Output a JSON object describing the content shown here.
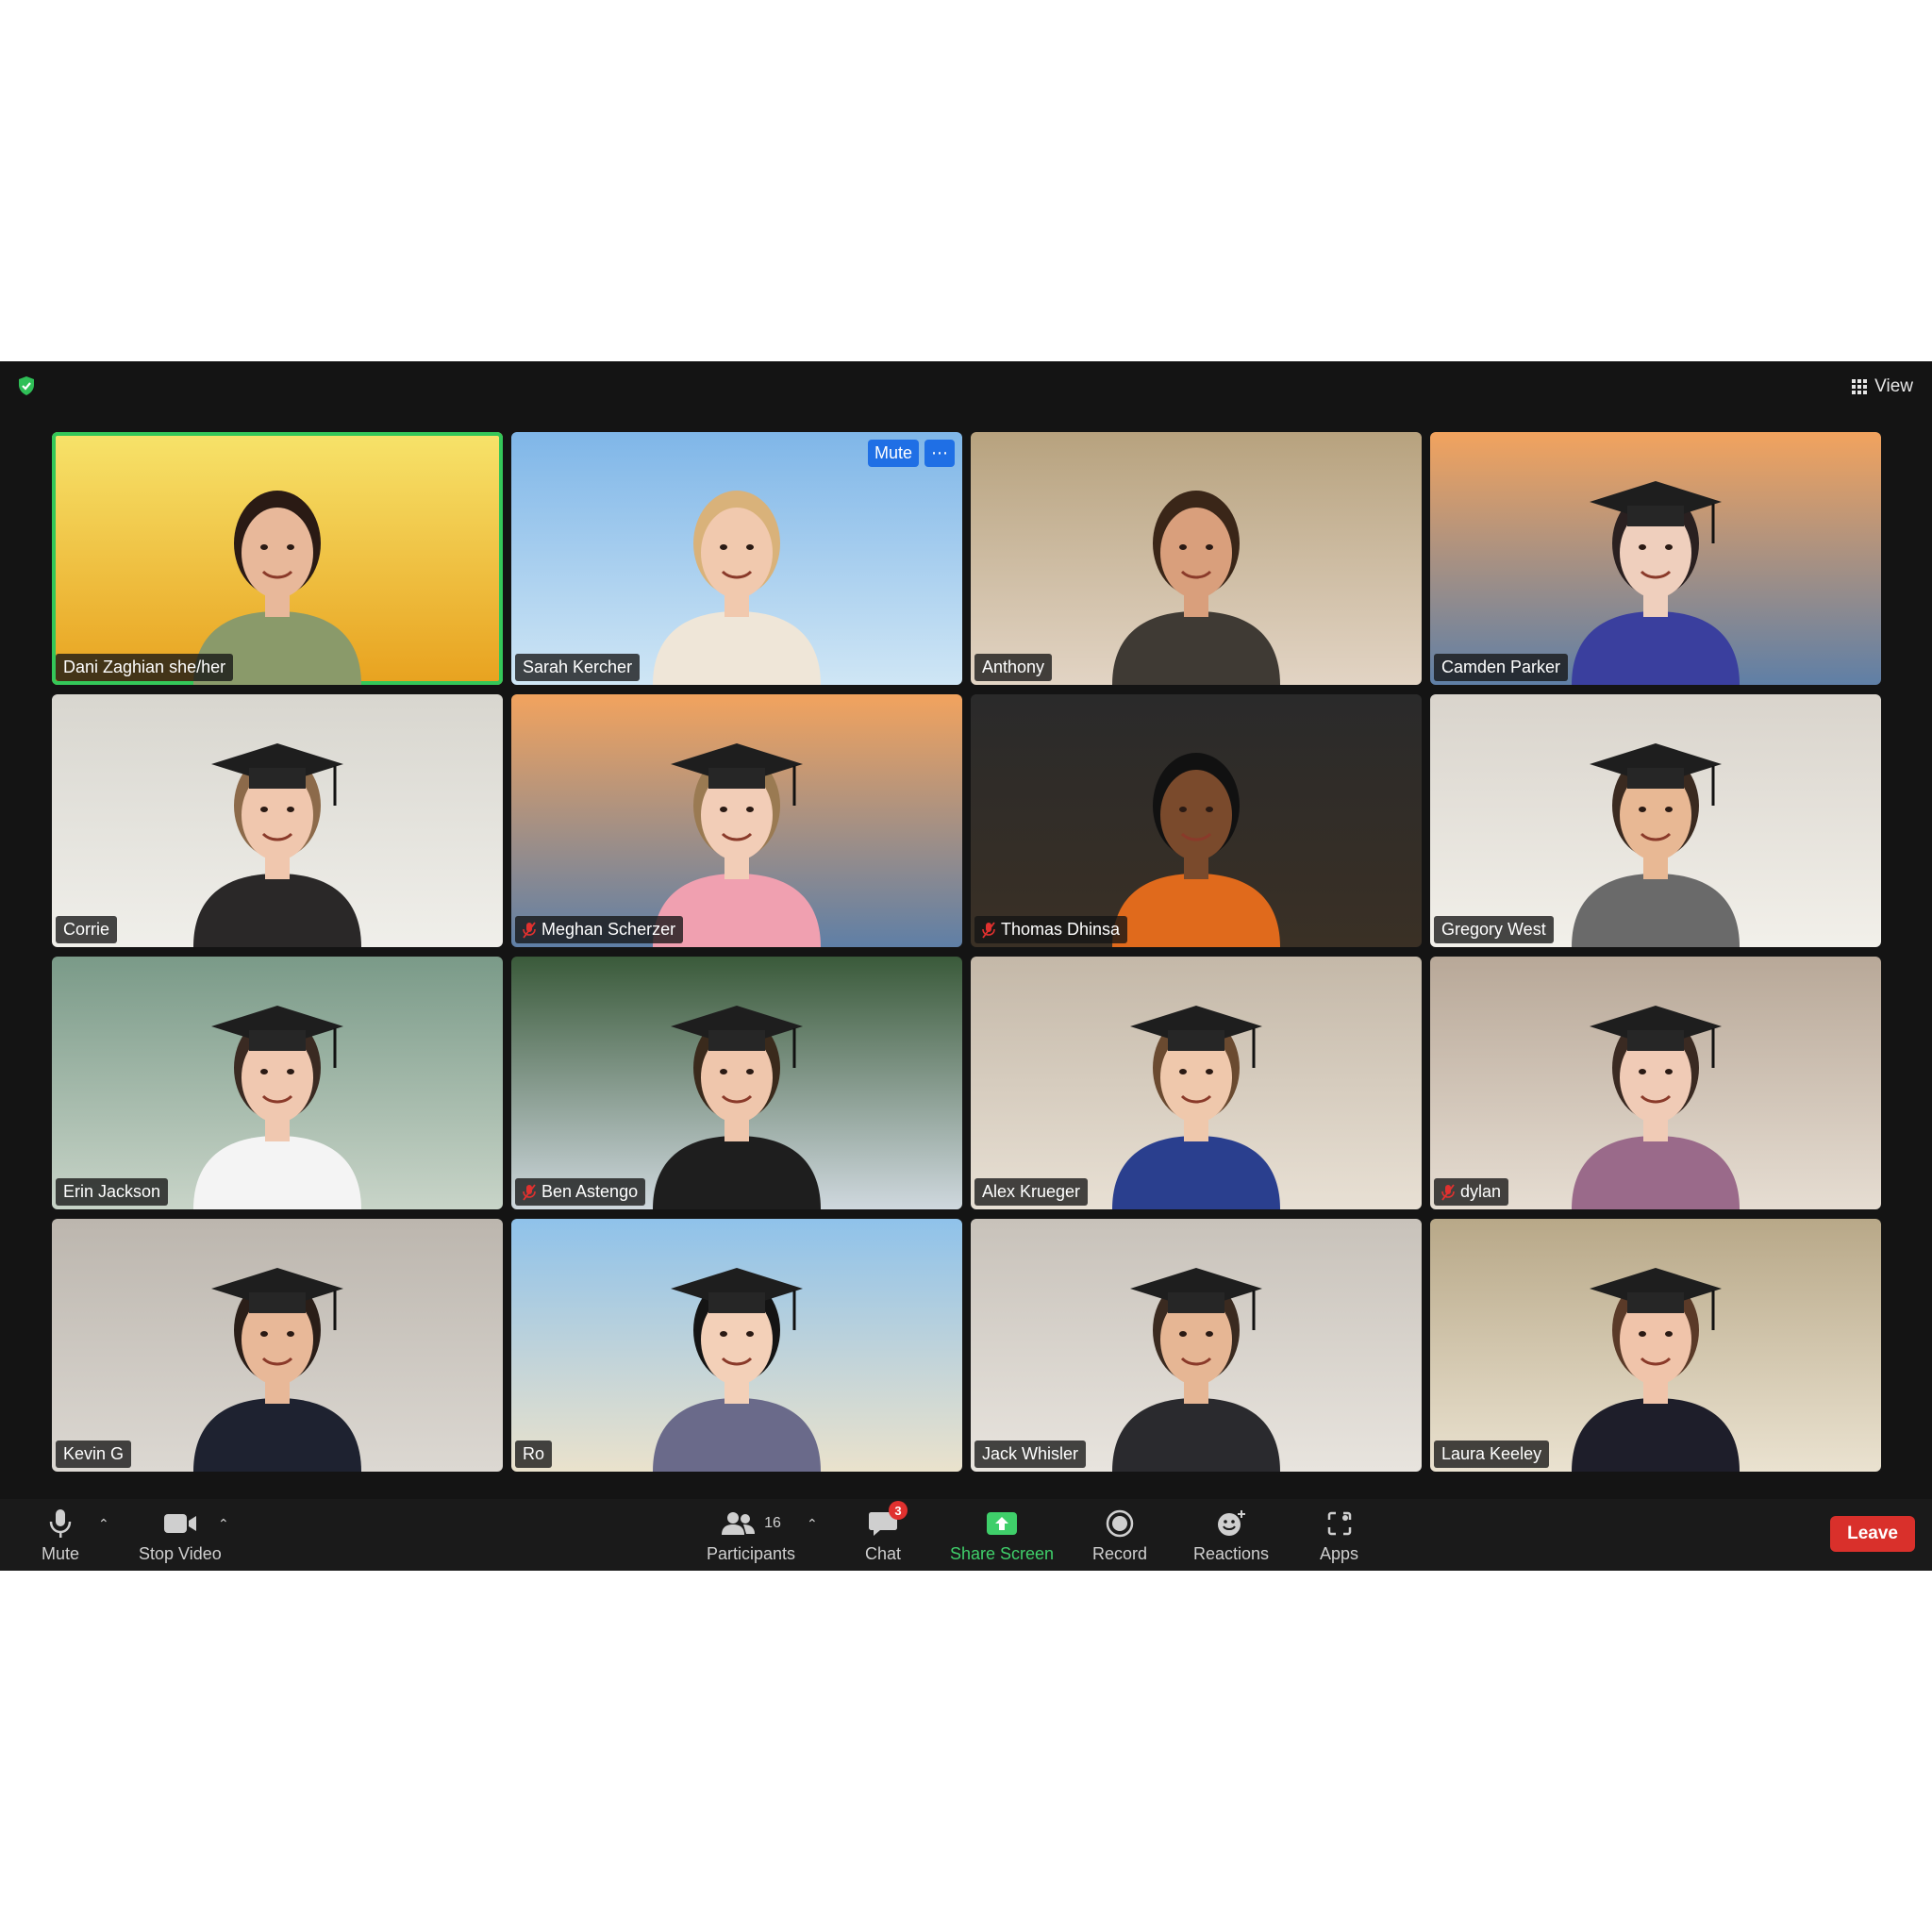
{
  "top_bar": {
    "view_label": "View"
  },
  "tile_controls": {
    "mute_label": "Mute",
    "more_label": "⋯"
  },
  "participants": [
    {
      "name": "Dani Zaghian she/her",
      "muted": false,
      "bg": [
        "#f7e36a",
        "#e8a21f"
      ],
      "skin": "#e8b89a",
      "hair": "#2a1a14",
      "shirt": "#8a9a6a",
      "cap": false,
      "active": true
    },
    {
      "name": "Sarah Kercher",
      "muted": false,
      "bg": [
        "#7fb6e8",
        "#cfe6f5"
      ],
      "skin": "#f1c9ae",
      "hair": "#d9b27a",
      "shirt": "#efe6d8",
      "cap": false
    },
    {
      "name": "Anthony",
      "muted": false,
      "bg": [
        "#b7a27e",
        "#e2d4c4"
      ],
      "skin": "#d99f7c",
      "hair": "#3a2618",
      "shirt": "#3f3a34",
      "cap": false
    },
    {
      "name": "Camden Parker",
      "muted": false,
      "bg": [
        "#f2a35e",
        "#5f7fa6"
      ],
      "skin": "#efcfbd",
      "hair": "#2a2020",
      "shirt": "#3a3f9e",
      "cap": true
    },
    {
      "name": "Corrie",
      "muted": false,
      "bg": [
        "#d8d6cf",
        "#f0efea"
      ],
      "skin": "#f0c7ae",
      "hair": "#8c6a4a",
      "shirt": "#2a2828",
      "cap": true
    },
    {
      "name": "Meghan Scherzer",
      "muted": true,
      "bg": [
        "#f2a35e",
        "#5f7fa6"
      ],
      "skin": "#f2cdb7",
      "hair": "#9a7a52",
      "shirt": "#f0a0b0",
      "cap": true
    },
    {
      "name": "Thomas Dhinsa",
      "muted": true,
      "bg": [
        "#2a2a2a",
        "#3a3025"
      ],
      "skin": "#7a4a2c",
      "hair": "#111111",
      "shirt": "#e06a1c",
      "cap": false
    },
    {
      "name": "Gregory West",
      "muted": false,
      "bg": [
        "#d9d4cc",
        "#f2f0ea"
      ],
      "skin": "#e8b894",
      "hair": "#3a2a20",
      "shirt": "#6a6a6a",
      "cap": true
    },
    {
      "name": "Erin Jackson",
      "muted": false,
      "bg": [
        "#7a9a88",
        "#c8d4c8"
      ],
      "skin": "#f0c8b0",
      "hair": "#3a2a22",
      "shirt": "#f4f4f4",
      "cap": true
    },
    {
      "name": "Ben Astengo",
      "muted": true,
      "bg": [
        "#3a5a3a",
        "#cfd8de"
      ],
      "skin": "#efc6ac",
      "hair": "#3a2a1c",
      "shirt": "#1e1e1e",
      "cap": true
    },
    {
      "name": "Alex Krueger",
      "muted": false,
      "bg": [
        "#c4b8a8",
        "#e8e0d4"
      ],
      "skin": "#efc8ac",
      "hair": "#6a4a30",
      "shirt": "#2a3f8e",
      "cap": true
    },
    {
      "name": "dylan",
      "muted": true,
      "bg": [
        "#b8a898",
        "#e6ddd2"
      ],
      "skin": "#f0cbb6",
      "hair": "#3a2a22",
      "shirt": "#9a6a8a",
      "cap": true
    },
    {
      "name": "Kevin G",
      "muted": false,
      "bg": [
        "#bcb6ae",
        "#dcd8d2"
      ],
      "skin": "#e8b898",
      "hair": "#2a1e18",
      "shirt": "#1e2230",
      "cap": true
    },
    {
      "name": "Ro",
      "muted": false,
      "bg": [
        "#8fc2ea",
        "#eae2cc"
      ],
      "skin": "#f3d0b8",
      "hair": "#141414",
      "shirt": "#6a6a8a",
      "cap": true
    },
    {
      "name": "Jack Whisler",
      "muted": false,
      "bg": [
        "#c8c2ba",
        "#e8e4de"
      ],
      "skin": "#e6b694",
      "hair": "#3a2a20",
      "shirt": "#2a2a2e",
      "cap": true
    },
    {
      "name": "Laura Keeley",
      "muted": false,
      "bg": [
        "#b8a888",
        "#eae2d0"
      ],
      "skin": "#f0c4aa",
      "hair": "#5a3a28",
      "shirt": "#1e1e2a",
      "cap": true
    }
  ],
  "toolbar": {
    "mute_label": "Mute",
    "stop_video_label": "Stop Video",
    "participants_label": "Participants",
    "participants_count": "16",
    "chat_label": "Chat",
    "chat_badge": "3",
    "share_label": "Share Screen",
    "record_label": "Record",
    "reactions_label": "Reactions",
    "apps_label": "Apps",
    "leave_label": "Leave"
  },
  "colors": {
    "accent_green": "#34c759",
    "share_green": "#3fcf6a",
    "leave_red": "#d9302b",
    "badge_red": "#e0312f",
    "app_bg": "#141414"
  }
}
